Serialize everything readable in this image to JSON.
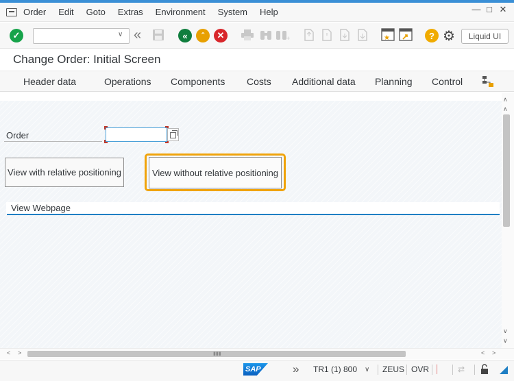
{
  "menubar": {
    "items": [
      "Order",
      "Edit",
      "Goto",
      "Extras",
      "Environment",
      "System",
      "Help"
    ]
  },
  "toolbar": {
    "command_field_value": "",
    "liquid_ui_label": "Liquid UI"
  },
  "title": "Change Order: Initial Screen",
  "app_toolbar": {
    "items": [
      "Header data",
      "Operations",
      "Components",
      "Costs",
      "Additional data",
      "Planning",
      "Control"
    ]
  },
  "form": {
    "order_label": "Order",
    "order_value": "",
    "btn_relative": "View with relative positioning",
    "btn_without_relative": "View without relative positioning",
    "webpage_title": "View Webpage"
  },
  "statusbar": {
    "system": "TR1 (1) 800",
    "server": "ZEUS",
    "mode": "OVR"
  },
  "colors": {
    "accent_blue": "#1f7fc4",
    "focus_orange": "#f0a30a",
    "enter_green": "#16a34a",
    "back_green": "#107e3e",
    "exit_orange": "#e8a000",
    "cancel_red": "#d8262b",
    "help_yellow": "#f0ab00"
  },
  "icons": [
    "menu-icon",
    "enter-icon",
    "dropdown-chevron-icon",
    "double-left-icon",
    "save-icon",
    "back-icon",
    "exit-icon",
    "cancel-icon",
    "print-icon",
    "find-icon",
    "find-next-icon",
    "first-page-icon",
    "previous-page-icon",
    "next-page-icon",
    "last-page-icon",
    "create-session-icon",
    "shortcut-icon",
    "help-icon",
    "settings-gear-icon",
    "flowchart-icon",
    "value-help-icon",
    "double-right-icon",
    "lock-icon",
    "resize-icon"
  ]
}
